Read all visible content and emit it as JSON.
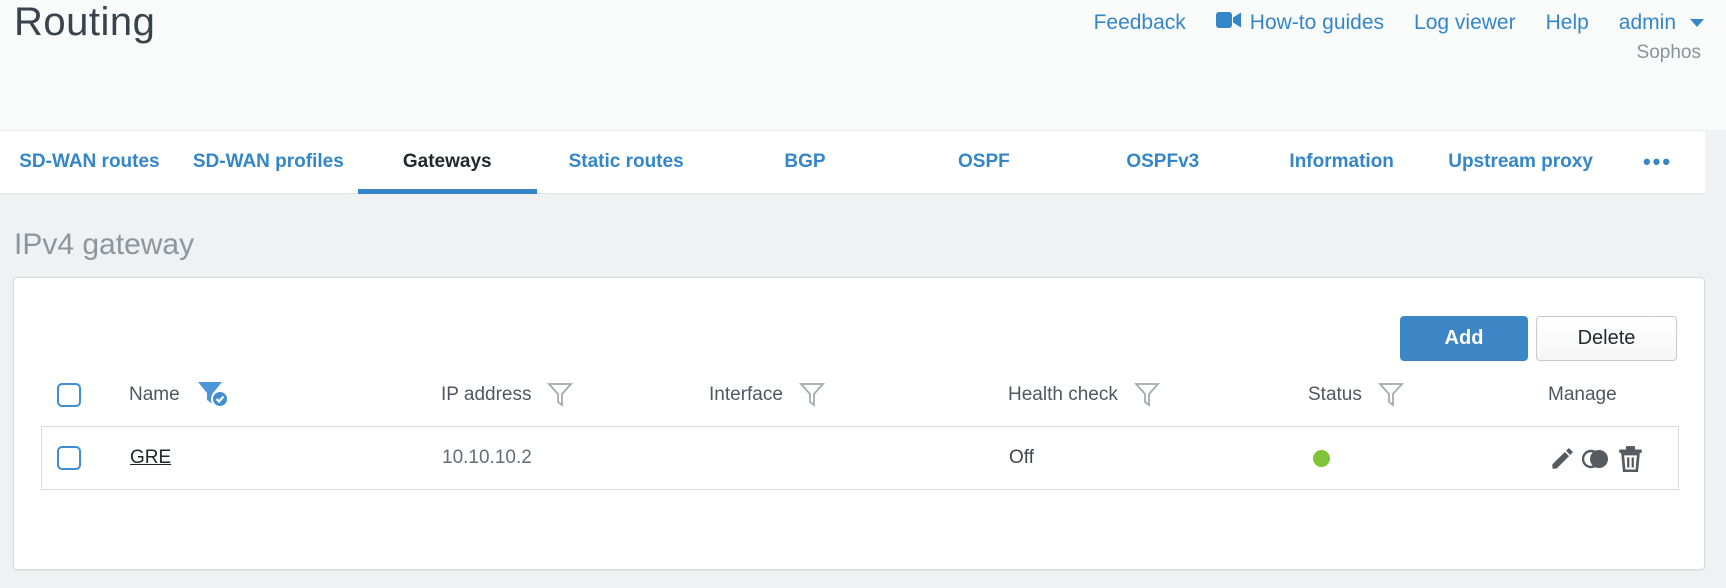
{
  "header": {
    "title": "Routing",
    "links": [
      {
        "label": "Feedback"
      },
      {
        "label": "How-to guides"
      },
      {
        "label": "Log viewer"
      },
      {
        "label": "Help"
      }
    ],
    "user_menu": "admin",
    "brand": "Sophos"
  },
  "tabs": {
    "items": [
      {
        "label": "SD-WAN routes",
        "active": false
      },
      {
        "label": "SD-WAN profiles",
        "active": false
      },
      {
        "label": "Gateways",
        "active": true
      },
      {
        "label": "Static routes",
        "active": false
      },
      {
        "label": "BGP",
        "active": false
      },
      {
        "label": "OSPF",
        "active": false
      },
      {
        "label": "OSPFv3",
        "active": false
      },
      {
        "label": "Information",
        "active": false
      },
      {
        "label": "Upstream proxy",
        "active": false
      }
    ],
    "more": "•••"
  },
  "section": {
    "title": "IPv4 gateway"
  },
  "toolbar": {
    "add_label": "Add",
    "delete_label": "Delete"
  },
  "table": {
    "columns": [
      {
        "label": "Name",
        "filter": "active"
      },
      {
        "label": "IP address",
        "filter": "inactive"
      },
      {
        "label": "Interface",
        "filter": "inactive"
      },
      {
        "label": "Health check",
        "filter": "inactive"
      },
      {
        "label": "Status",
        "filter": "inactive"
      },
      {
        "label": "Manage",
        "filter": "none"
      }
    ],
    "rows": [
      {
        "name": "GRE",
        "ip_address": "10.10.10.2",
        "interface": "",
        "health_check": "Off",
        "status": "up",
        "manage_icons": [
          "edit",
          "clone",
          "delete"
        ]
      }
    ]
  },
  "colors": {
    "accent_blue": "#3486c9",
    "add_button_blue": "#3d86c6",
    "status_up_green": "#7fc338"
  }
}
